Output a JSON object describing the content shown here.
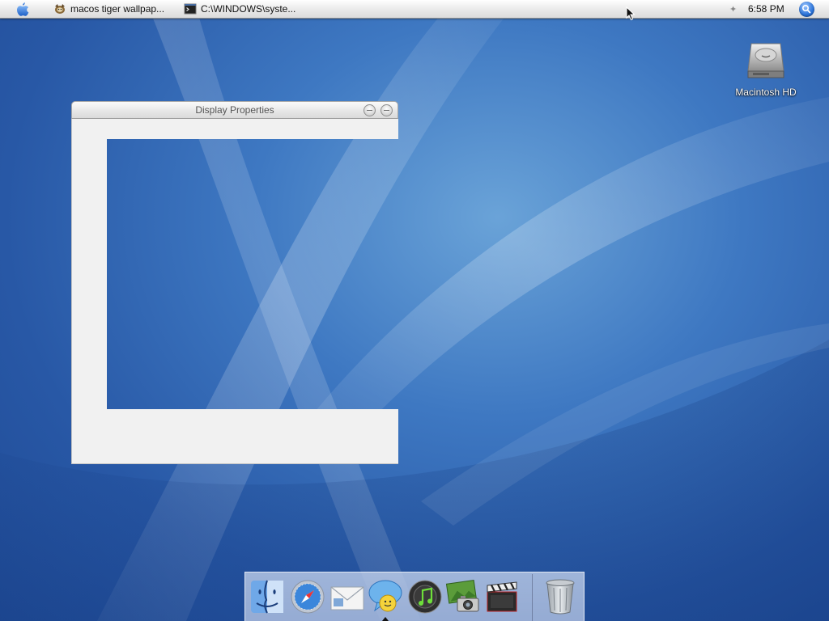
{
  "menubar": {
    "apple_icon": "apple-icon",
    "tasks": [
      {
        "label": "macos tiger wallpap...",
        "icon": "browser-icon"
      },
      {
        "label": "C:\\WINDOWS\\syste...",
        "icon": "command-prompt-icon"
      }
    ],
    "clock": "6:58 PM",
    "spotlight_icon": "spotlight-icon"
  },
  "desktop": {
    "icons": [
      {
        "label": "Macintosh HD",
        "icon": "hard-drive-icon"
      }
    ]
  },
  "window": {
    "title": "Display Properties"
  },
  "dock": {
    "items": [
      {
        "name": "finder",
        "icon": "finder-icon"
      },
      {
        "name": "safari",
        "icon": "safari-icon"
      },
      {
        "name": "mail",
        "icon": "mail-icon"
      },
      {
        "name": "ichat",
        "icon": "ichat-icon",
        "running": true
      },
      {
        "name": "itunes",
        "icon": "itunes-icon"
      },
      {
        "name": "iphoto",
        "icon": "iphoto-icon"
      },
      {
        "name": "imovie",
        "icon": "imovie-icon"
      },
      {
        "name": "trash",
        "icon": "trash-icon"
      }
    ]
  },
  "colors": {
    "wallpaper_blue": "#2a5fae",
    "window_gray": "#f1f1f1",
    "menubar_bg": "#e9e9e9"
  }
}
